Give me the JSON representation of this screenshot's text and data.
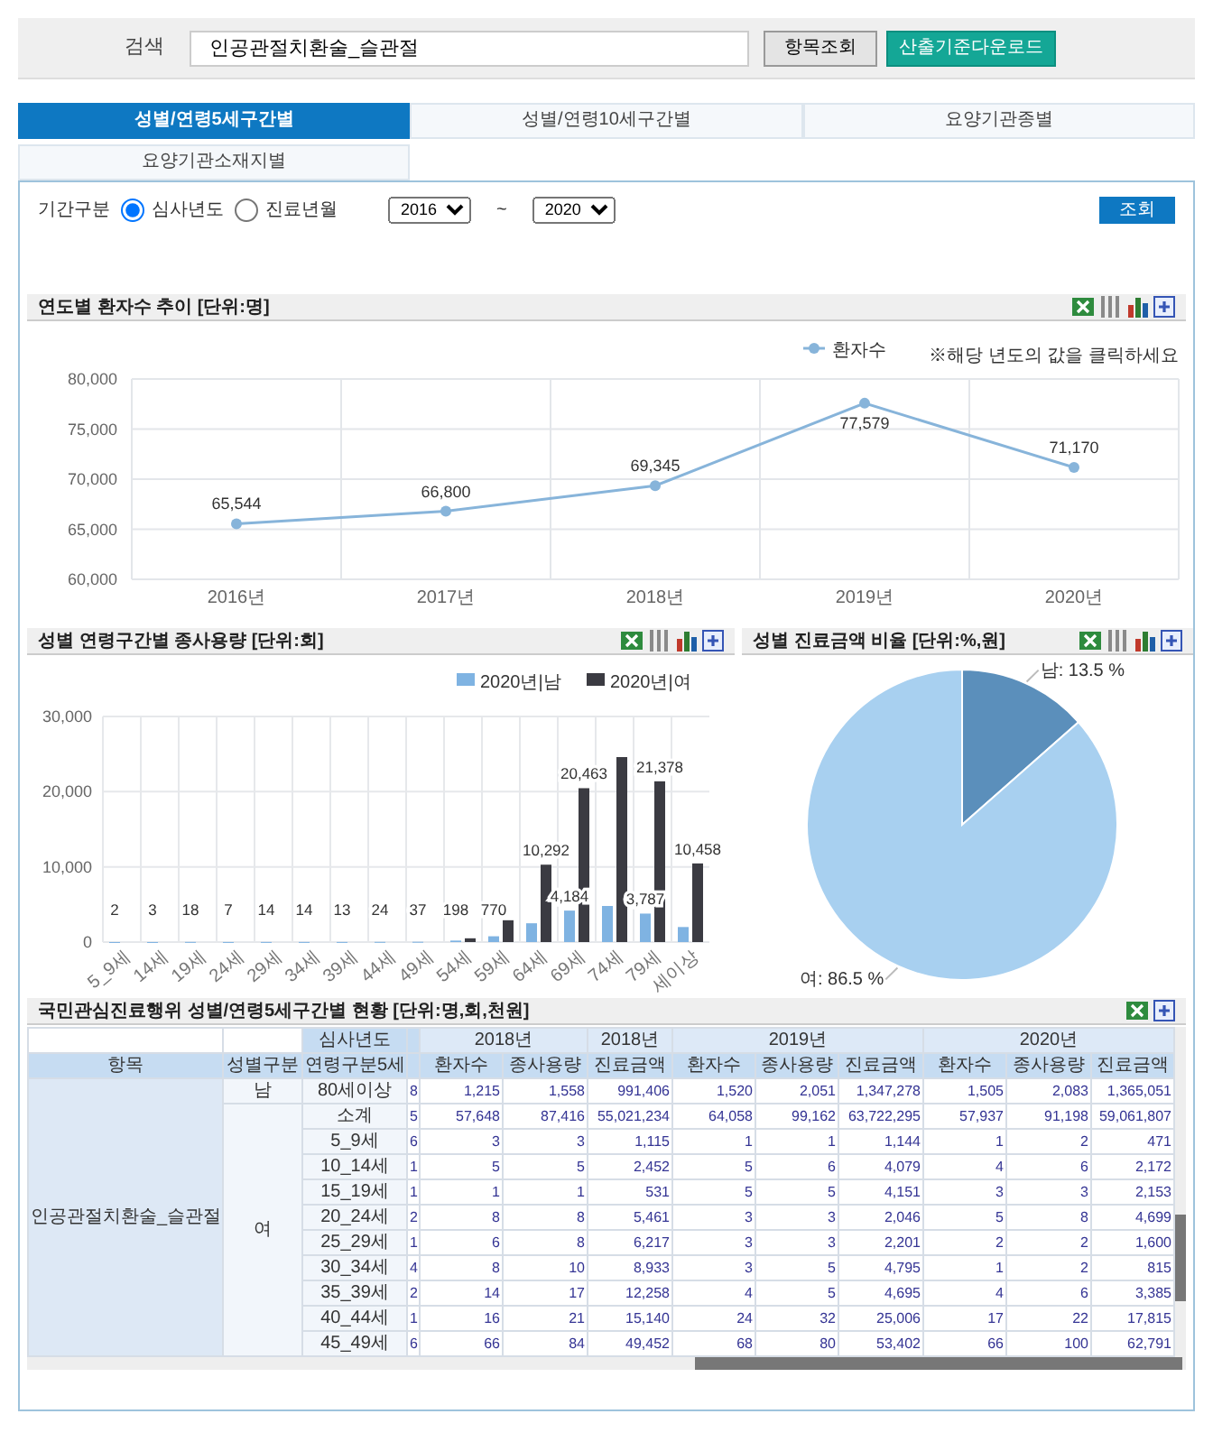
{
  "search": {
    "label": "검색",
    "value": "인공관절치환술_슬관절",
    "buttons": [
      {
        "label": "항목조회",
        "kind": "plain"
      },
      {
        "label": "산출기준다운로드",
        "kind": "download"
      }
    ]
  },
  "tabs": [
    {
      "label": "성별/연령5세구간별",
      "selected": true
    },
    {
      "label": "성별/연령10세구간별",
      "selected": false
    },
    {
      "label": "요양기관종별",
      "selected": false
    },
    {
      "label": "요양기관소재지별",
      "selected": false
    }
  ],
  "filter": {
    "label": "기간구분",
    "options": [
      {
        "label": "심사년도",
        "selected": true
      },
      {
        "label": "진료년월",
        "selected": false
      }
    ],
    "from": "2016",
    "separator": "~",
    "to": "2020",
    "button": "조회"
  },
  "line_panel": {
    "title": "연도별 환자수 추이 [단위:명]",
    "note": "※해당 년도의 값을 클릭하세요",
    "chart_data": {
      "type": "line",
      "categories": [
        "2016년",
        "2017년",
        "2018년",
        "2019년",
        "2020년"
      ],
      "series": [
        {
          "name": "환자수",
          "color": "#87b4da",
          "marker": true,
          "values": [
            65544,
            66800,
            69345,
            77579,
            71170
          ],
          "value_labels": [
            "65,544",
            "66,800",
            "69,345",
            "77,579",
            "71,170"
          ]
        }
      ],
      "ylim": [
        60000,
        80000
      ],
      "yticks": [
        {
          "value": 60000,
          "label": "60,000"
        },
        {
          "value": 65000,
          "label": "65,000"
        },
        {
          "value": 70000,
          "label": "70,000"
        },
        {
          "value": 75000,
          "label": "75,000"
        },
        {
          "value": 80000,
          "label": "80,000"
        }
      ],
      "grid": true,
      "legend": "top-right"
    }
  },
  "bar_panel": {
    "title": "성별 연령구간별 종사용량 [단위:회]",
    "chart_data": {
      "type": "bar",
      "categories": [
        "5_9세",
        "14세",
        "19세",
        "24세",
        "29세",
        "34세",
        "39세",
        "44세",
        "49세",
        "54세",
        "59세",
        "64세",
        "69세",
        "74세",
        "79세",
        "세이상"
      ],
      "series": [
        {
          "name": "2020년|남",
          "color": "#7fb3e2",
          "values": [
            2,
            3,
            18,
            7,
            14,
            14,
            13,
            24,
            37,
            198,
            770,
            2500,
            4184,
            4800,
            3787,
            2000
          ],
          "value_labels": [
            "2",
            "3",
            "18",
            "7",
            "14",
            "14",
            "13",
            "24",
            "37",
            "198",
            "770",
            null,
            "4,184",
            null,
            "3,787",
            null
          ]
        },
        {
          "name": "2020년|여",
          "color": "#3b3b42",
          "values": [
            0,
            0,
            0,
            0,
            0,
            0,
            0,
            0,
            0,
            500,
            2900,
            10292,
            20463,
            24600,
            21378,
            10458
          ],
          "value_labels": [
            null,
            null,
            null,
            null,
            null,
            null,
            null,
            null,
            null,
            null,
            null,
            "10,292",
            "20,463",
            null,
            "21,378",
            "10,458"
          ]
        }
      ],
      "ylim": [
        0,
        30000
      ],
      "yticks": [
        {
          "value": 0,
          "label": "0"
        },
        {
          "value": 10000,
          "label": "10,000"
        },
        {
          "value": 20000,
          "label": "20,000"
        },
        {
          "value": 30000,
          "label": "30,000"
        }
      ],
      "grid": true,
      "legend": "top-right"
    }
  },
  "pie_panel": {
    "title": "성별 진료금액 비율 [단위:%,원]",
    "chart_data": {
      "type": "pie",
      "values": [
        13.5,
        86.5
      ],
      "colors": [
        "#5b8fbb",
        "#a8d0f0"
      ],
      "value_labels": [
        "남: 13.5 %",
        "여: 86.5 %"
      ]
    }
  },
  "table_panel": {
    "title": "국민관심진료행위 성별/연령5세구간별 현황 [단위:명,회,천원]",
    "fixed_headers": {
      "item": "항목",
      "sex": "성별구분",
      "year_label": "심사년도",
      "age": "연령구분5세"
    },
    "year_headers": [
      {
        "label": "2018년",
        "columns": [
          "환자수",
          "종사용량"
        ]
      },
      {
        "label": "2018년",
        "columns": [
          "진료금액"
        ]
      },
      {
        "label": "2019년",
        "columns": [
          "환자수",
          "종사용량",
          "진료금액"
        ]
      },
      {
        "label": "2020년",
        "columns": [
          "환자수",
          "종사용량",
          "진료금액"
        ]
      }
    ],
    "item": "인공관절치환술_슬관절",
    "groups": [
      {
        "sex": "남",
        "rows": [
          {
            "age": "80세이상",
            "cut": "8",
            "values": [
              "1,215",
              "1,558",
              "991,406",
              "1,520",
              "2,051",
              "1,347,278",
              "1,505",
              "2,083",
              "1,365,051"
            ]
          }
        ]
      },
      {
        "sex": "여",
        "rows": [
          {
            "age": "소계",
            "cut": "5",
            "values": [
              "57,648",
              "87,416",
              "55,021,234",
              "64,058",
              "99,162",
              "63,722,295",
              "57,937",
              "91,198",
              "59,061,807"
            ]
          },
          {
            "age": "5_9세",
            "cut": "6",
            "values": [
              "3",
              "3",
              "1,115",
              "1",
              "1",
              "1,144",
              "1",
              "2",
              "471"
            ]
          },
          {
            "age": "10_14세",
            "cut": "1",
            "values": [
              "5",
              "5",
              "2,452",
              "5",
              "6",
              "4,079",
              "4",
              "6",
              "2,172"
            ]
          },
          {
            "age": "15_19세",
            "cut": "1",
            "values": [
              "1",
              "1",
              "531",
              "5",
              "5",
              "4,151",
              "3",
              "3",
              "2,153"
            ]
          },
          {
            "age": "20_24세",
            "cut": "2",
            "values": [
              "8",
              "8",
              "5,461",
              "3",
              "3",
              "2,046",
              "5",
              "8",
              "4,699"
            ]
          },
          {
            "age": "25_29세",
            "cut": "1",
            "values": [
              "6",
              "8",
              "6,217",
              "3",
              "3",
              "2,201",
              "2",
              "2",
              "1,600"
            ]
          },
          {
            "age": "30_34세",
            "cut": "4",
            "values": [
              "8",
              "10",
              "8,933",
              "3",
              "5",
              "4,795",
              "1",
              "2",
              "815"
            ]
          },
          {
            "age": "35_39세",
            "cut": "2",
            "values": [
              "14",
              "17",
              "12,258",
              "4",
              "5",
              "4,695",
              "4",
              "6",
              "3,385"
            ]
          },
          {
            "age": "40_44세",
            "cut": "1",
            "values": [
              "16",
              "21",
              "15,140",
              "24",
              "32",
              "25,006",
              "17",
              "22",
              "17,815"
            ]
          },
          {
            "age": "45_49세",
            "cut": "6",
            "values": [
              "66",
              "84",
              "49,452",
              "68",
              "80",
              "53,402",
              "66",
              "100",
              "62,791"
            ]
          }
        ]
      }
    ]
  }
}
